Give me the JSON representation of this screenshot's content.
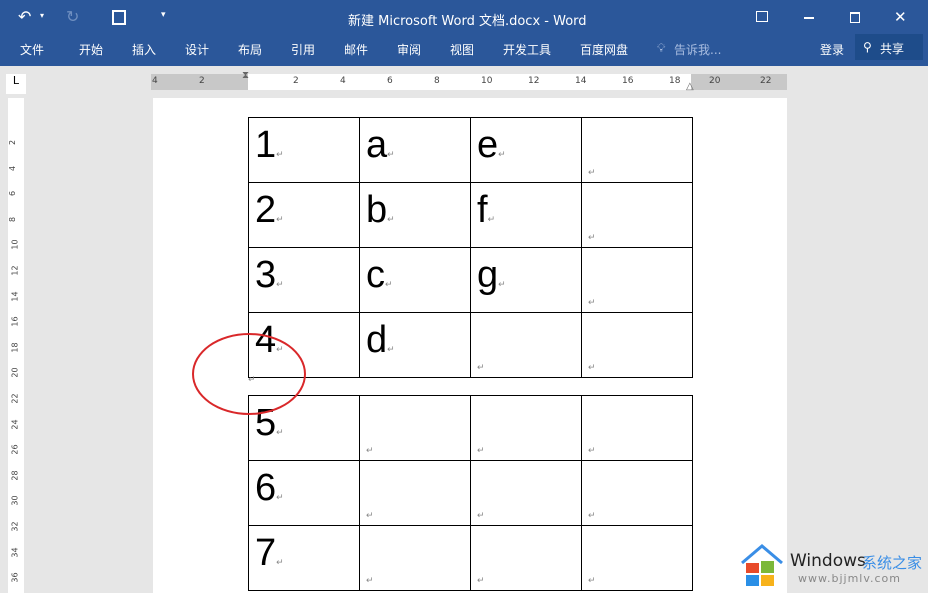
{
  "window": {
    "title": "新建 Microsoft Word 文档.docx - Word"
  },
  "ribbon": {
    "tabs": [
      "文件",
      "开始",
      "插入",
      "设计",
      "布局",
      "引用",
      "邮件",
      "审阅",
      "视图",
      "开发工具",
      "百度网盘"
    ],
    "tell_me": "告诉我...",
    "login": "登录",
    "share": "共享"
  },
  "ruler": {
    "h_labels": [
      "4",
      "2",
      "",
      "2",
      "4",
      "6",
      "8",
      "10",
      "12",
      "14",
      "16",
      "18",
      "20",
      "22"
    ],
    "v_labels": [
      "2",
      "4",
      "6",
      "8",
      "10",
      "12",
      "14",
      "16",
      "18",
      "20",
      "22",
      "24",
      "26",
      "28",
      "30",
      "32",
      "34",
      "36"
    ]
  },
  "document": {
    "table1": [
      [
        "1",
        "a",
        "e",
        ""
      ],
      [
        "2",
        "b",
        "f",
        ""
      ],
      [
        "3",
        "c",
        "g",
        ""
      ],
      [
        "4",
        "d",
        "",
        ""
      ]
    ],
    "table2": [
      [
        "5",
        "",
        "",
        ""
      ],
      [
        "6",
        "",
        "",
        ""
      ],
      [
        "7",
        "",
        "",
        ""
      ]
    ],
    "paragraph_mark": "↵"
  },
  "annotation": {
    "circle_color": "#d9282a"
  },
  "watermark": {
    "brand": "Windows",
    "brand_cn": "系统之家",
    "url": "www.bjjmlv.com"
  },
  "colors": {
    "title_bar": "#2b579a"
  }
}
